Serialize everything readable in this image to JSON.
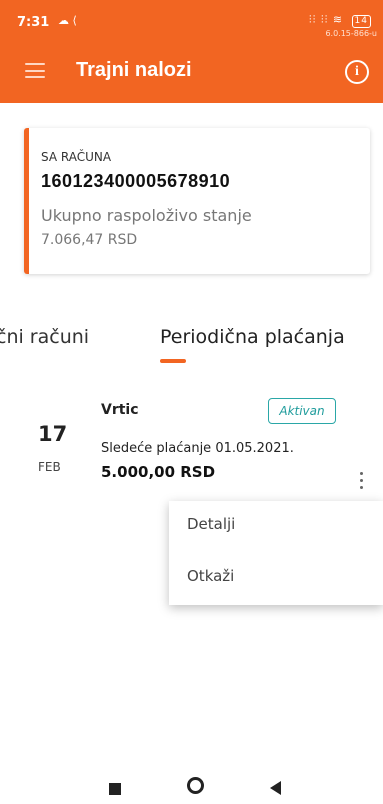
{
  "status_bar": {
    "time": "7:31",
    "left_icons": "☁ ⟨",
    "right_icons": "⫶⫶ ⫶⫶ ≋",
    "battery": "14",
    "version": "6.0.15-866-u"
  },
  "header": {
    "title": "Trajni nalozi",
    "menu_icon": "hamburger-menu-icon",
    "info_icon": "info-icon",
    "info_glyph": "i"
  },
  "account": {
    "label": "SA RAČUNA",
    "number": "160123400005678910",
    "balance_label": "Ukupno raspoloživo stanje",
    "balance": "7.066,47 RSD"
  },
  "tabs": {
    "left_label": "čni računi",
    "right_label": "Periodična plaćanja",
    "active": "right"
  },
  "payment": {
    "day": "17",
    "month": "FEB",
    "payee": "Vrtic",
    "status": "Aktivan",
    "next_payment": "Sledeće plaćanje 01.05.2021.",
    "amount": "5.000,00 RSD"
  },
  "menu": {
    "items": [
      "Detalji",
      "Otkaži"
    ]
  },
  "colors": {
    "brand": "#f26522",
    "badge": "#2aa7a7"
  }
}
